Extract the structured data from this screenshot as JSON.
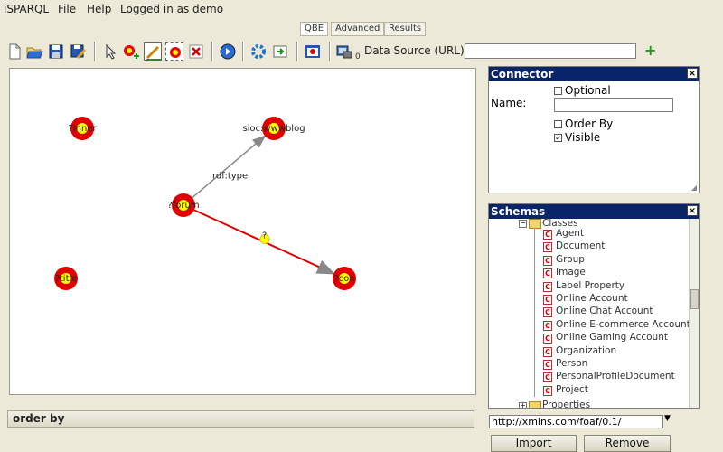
{
  "menu": {
    "app": "iSPARQL",
    "file": "File",
    "help": "Help",
    "user": "Logged in as demo"
  },
  "tabs": [
    "QBE",
    "Advanced",
    "Results"
  ],
  "toolbar": {
    "badge": "0",
    "data_source_label": "Data Source (URL):",
    "data_source_value": "",
    "add_symbol": "+"
  },
  "graph": {
    "nodes": [
      {
        "id": "n1",
        "label": "?Inner"
      },
      {
        "id": "n2",
        "label": "sioc:wwwblog"
      },
      {
        "id": "n3",
        "label": "?forum"
      },
      {
        "id": "n4",
        "label": "?title"
      },
      {
        "id": "n5",
        "label": "?con"
      }
    ],
    "edges": [
      {
        "from": "n3",
        "to": "n2",
        "label": "rdf:type",
        "color": "#888888"
      },
      {
        "from": "n3",
        "to": "n5",
        "label": "?",
        "color": "#e00000"
      }
    ]
  },
  "orderby": {
    "label": "order by"
  },
  "connector": {
    "title": "Connector",
    "close": "×",
    "name_label": "Name:",
    "name_value": "",
    "optional": {
      "label": "Optional",
      "checked": false
    },
    "order_by": {
      "label": "Order By",
      "checked": false
    },
    "visible": {
      "label": "Visible",
      "checked": true
    }
  },
  "schemas": {
    "title": "Schemas",
    "close": "×",
    "folder": "Classes",
    "items": [
      "Agent",
      "Document",
      "Group",
      "Image",
      "Label Property",
      "Online Account",
      "Online Chat Account",
      "Online E-commerce Account",
      "Online Gaming Account",
      "Organization",
      "Person",
      "PersonalProfileDocument",
      "Project"
    ],
    "next_folder": "Properties",
    "namespace": "http://xmlns.com/foaf/0.1/",
    "import_label": "Import",
    "remove_label": "Remove"
  },
  "colors": {
    "accent": "#0a246a",
    "node_outer": "#e00000",
    "node_inner": "#ffff00"
  }
}
